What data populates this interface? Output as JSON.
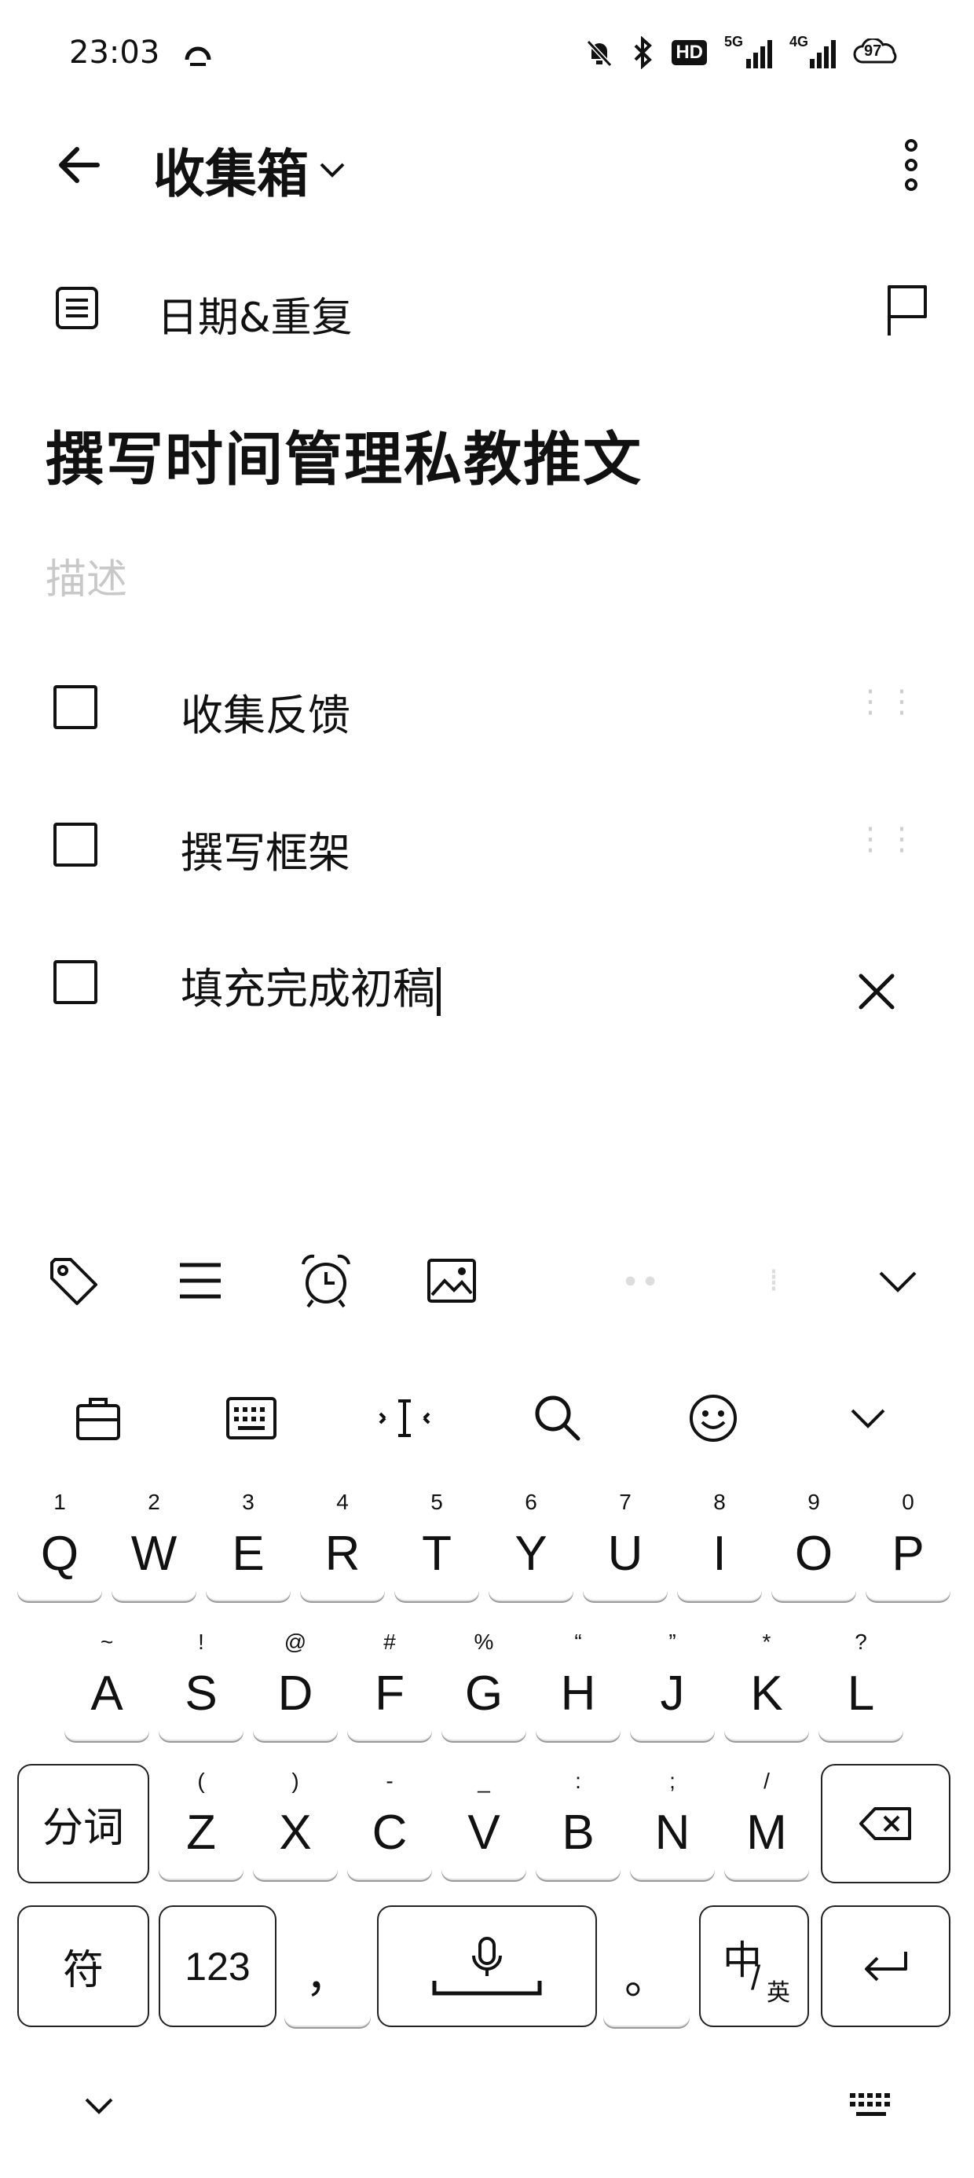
{
  "status_bar": {
    "time": "23:03",
    "icons": [
      "dnd-bell-icon",
      "bluetooth-icon",
      "hd-icon",
      "5g-signal-icon",
      "4g-signal-icon",
      "battery-icon"
    ],
    "battery_level": "97",
    "network_5g": "5G",
    "network_4g": "4G",
    "hd": "HD"
  },
  "header": {
    "title": "收集箱",
    "back_icon": "arrow-left-icon",
    "more_icon": "more-vertical-icon"
  },
  "meta_row": {
    "date_repeat_label": "日期&重复",
    "note_icon": "note-list-icon",
    "flag_icon": "flag-icon"
  },
  "task": {
    "title": "撰写时间管理私教推文",
    "description_placeholder": "描述"
  },
  "checklist": [
    {
      "text": "收集反馈",
      "checked": false
    },
    {
      "text": "撰写框架",
      "checked": false
    },
    {
      "text": "填充完成初稿",
      "checked": false,
      "editing": true
    }
  ],
  "toolbar": {
    "icons": [
      "tag-icon",
      "list-icon",
      "alarm-clock-icon",
      "image-icon",
      "chevron-down-icon"
    ]
  },
  "keyboard": {
    "top_icons": [
      "clipboard-icon",
      "keyboard-icon",
      "cursor-move-icon",
      "search-icon",
      "emoji-icon",
      "chevron-down-icon"
    ],
    "row1": [
      {
        "num": "1",
        "key": "Q"
      },
      {
        "num": "2",
        "key": "W"
      },
      {
        "num": "3",
        "key": "E"
      },
      {
        "num": "4",
        "key": "R"
      },
      {
        "num": "5",
        "key": "T"
      },
      {
        "num": "6",
        "key": "Y"
      },
      {
        "num": "7",
        "key": "U"
      },
      {
        "num": "8",
        "key": "I"
      },
      {
        "num": "9",
        "key": "O"
      },
      {
        "num": "0",
        "key": "P"
      }
    ],
    "row2": [
      {
        "sym": "~",
        "key": "A"
      },
      {
        "sym": "!",
        "key": "S"
      },
      {
        "sym": "@",
        "key": "D"
      },
      {
        "sym": "#",
        "key": "F"
      },
      {
        "sym": "%",
        "key": "G"
      },
      {
        "sym": "“",
        "key": "H"
      },
      {
        "sym": "”",
        "key": "J"
      },
      {
        "sym": "*",
        "key": "K"
      },
      {
        "sym": "?",
        "key": "L"
      }
    ],
    "row3": [
      {
        "sym": "(",
        "key": "Z"
      },
      {
        "sym": ")",
        "key": "X"
      },
      {
        "sym": "-",
        "key": "C"
      },
      {
        "sym": "_",
        "key": "V"
      },
      {
        "sym": ":",
        "key": "B"
      },
      {
        "sym": ";",
        "key": "N"
      },
      {
        "sym": "/",
        "key": "M"
      }
    ],
    "segment_label": "分词",
    "symbol_label": "符",
    "number_label": "123",
    "comma_label": "，",
    "period_label": "。",
    "lang_main": "中",
    "lang_sub": "英",
    "lang_sep": "/"
  }
}
